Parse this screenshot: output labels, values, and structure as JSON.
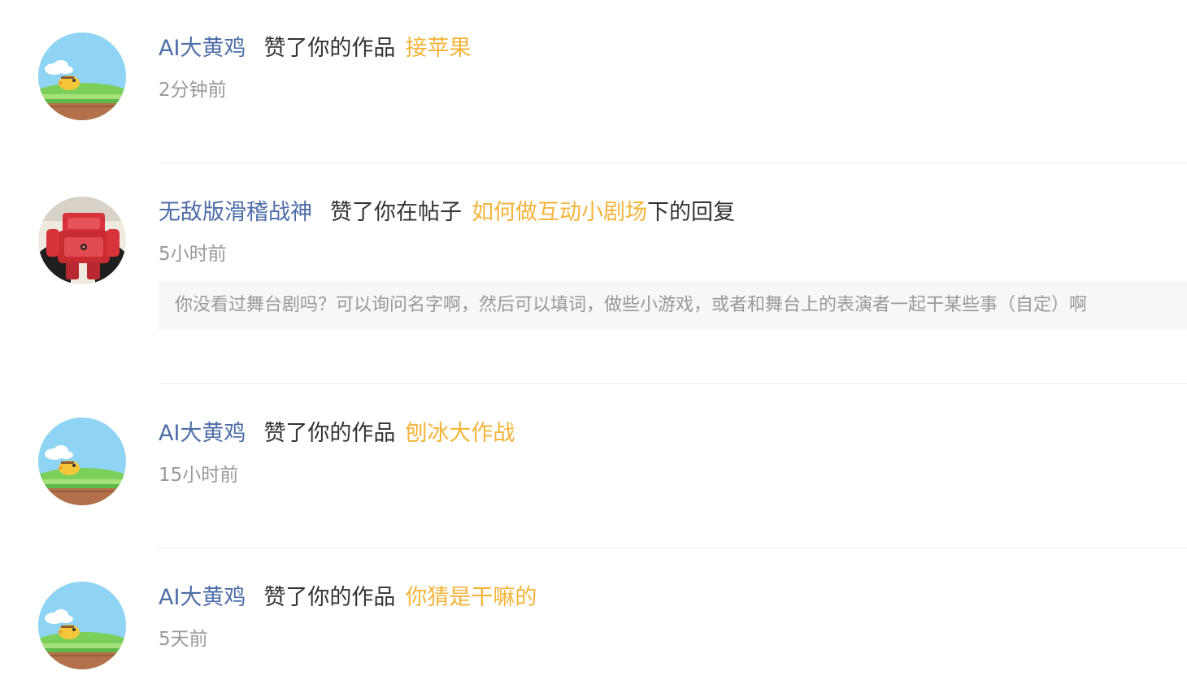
{
  "notifications": [
    {
      "user": "AI大黄鸡",
      "action": "赞了你的作品",
      "target": "接苹果",
      "time": "2分钟前",
      "avatar_icon": "yellow-chick-game-avatar-icon"
    },
    {
      "user": "无敌版滑稽战神",
      "action": "赞了你在帖子",
      "target": "如何做互动小剧场",
      "suffix": "下的回复",
      "time": "5小时前",
      "quote": "你没看过舞台剧吗？可以询问名字啊，然后可以填词，做些小游戏，或者和舞台上的表演者一起干某些事（自定）啊",
      "avatar_icon": "red-robot-avatar-icon"
    },
    {
      "user": "AI大黄鸡",
      "action": "赞了你的作品",
      "target": "刨冰大作战",
      "time": "15小时前",
      "avatar_icon": "yellow-chick-game-avatar-icon"
    },
    {
      "user": "AI大黄鸡",
      "action": "赞了你的作品",
      "target": "你猜是干嘛的",
      "time": "5天前",
      "avatar_icon": "yellow-chick-game-avatar-icon"
    }
  ],
  "colors": {
    "username": "#4e6ea8",
    "target": "#f4b43a",
    "body_text": "#333333",
    "timestamp": "#999999",
    "quote_bg": "#f7f7f7",
    "divider": "#ececec"
  }
}
